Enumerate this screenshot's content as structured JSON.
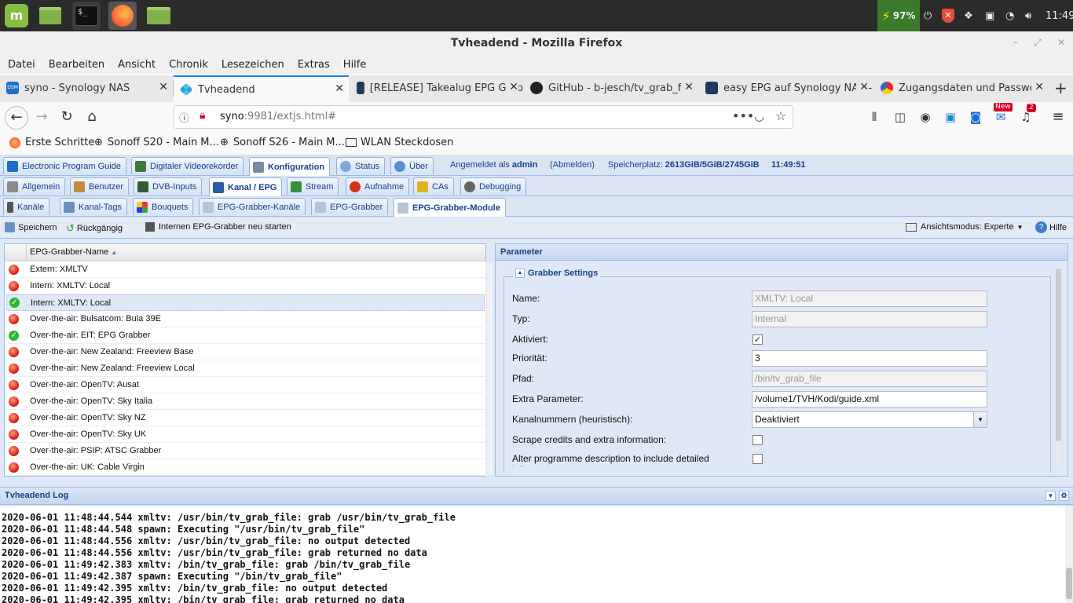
{
  "taskbar": {
    "battery": "97%",
    "clock": "11:49"
  },
  "window": {
    "title": "Tvheadend - Mozilla Firefox"
  },
  "menubar": [
    "Datei",
    "Bearbeiten",
    "Ansicht",
    "Chronik",
    "Lesezeichen",
    "Extras",
    "Hilfe"
  ],
  "tabs": [
    {
      "label": "syno - Synology NAS",
      "icon": "dsm-icon"
    },
    {
      "label": "Tvheadend",
      "icon": "tvheadend-icon"
    },
    {
      "label": "[RELEASE] Takealug EPG Grab",
      "icon": "kodi-icon"
    },
    {
      "label": "GitHub - b-jesch/tv_grab_file",
      "icon": "github-icon"
    },
    {
      "label": "easy EPG auf Synology NAS -",
      "icon": "kodi-icon"
    },
    {
      "label": "Zugangsdaten und Passwört",
      "icon": "takealug-icon"
    }
  ],
  "url": {
    "host": "syno",
    "rest": ":9981/extjs.html#"
  },
  "toolbar_badges": {
    "new": "New",
    "count": "2"
  },
  "bookmarks": [
    "Erste Schritte",
    "Sonoff S20 - Main M...",
    "Sonoff S26 - Main M...",
    "WLAN Steckdosen"
  ],
  "tvh": {
    "main_tabs": [
      "Electronic Program Guide",
      "Digitaler Videorekorder",
      "Konfiguration",
      "Status",
      "Über"
    ],
    "info": {
      "logged_in_prefix": "Angemeldet als",
      "user": "admin",
      "logout": "(Abmelden)",
      "storage_label": "Speicherplatz:",
      "storage_value": "2613GiB/5GiB/2745GiB",
      "time": "11:49:51"
    },
    "config_tabs": [
      "Allgemein",
      "Benutzer",
      "DVB-Inputs",
      "Kanal / EPG",
      "Stream",
      "Aufnahme",
      "CAs",
      "Debugging"
    ],
    "epg_tabs": [
      "Kanäle",
      "Kanal-Tags",
      "Bouquets",
      "EPG-Grabber-Kanäle",
      "EPG-Grabber",
      "EPG-Grabber-Module"
    ],
    "actions": {
      "save": "Speichern",
      "undo": "Rückgängig",
      "restart": "Internen EPG-Grabber neu starten",
      "view_mode": "Ansichtsmodus: Experte",
      "help": "Hilfe"
    },
    "grid": {
      "column": "EPG-Grabber-Name",
      "rows": [
        {
          "name": "Extern: XMLTV",
          "status": "red"
        },
        {
          "name": "Intern: XMLTV: Local",
          "status": "red"
        },
        {
          "name": "Intern: XMLTV: Local",
          "status": "green"
        },
        {
          "name": "Over-the-air: Bulsatcom: Bula 39E",
          "status": "red"
        },
        {
          "name": "Over-the-air: EIT: EPG Grabber",
          "status": "green"
        },
        {
          "name": "Over-the-air: New Zealand: Freeview Base",
          "status": "red"
        },
        {
          "name": "Over-the-air: New Zealand: Freeview Local",
          "status": "red"
        },
        {
          "name": "Over-the-air: OpenTV: Ausat",
          "status": "red"
        },
        {
          "name": "Over-the-air: OpenTV: Sky Italia",
          "status": "red"
        },
        {
          "name": "Over-the-air: OpenTV: Sky NZ",
          "status": "red"
        },
        {
          "name": "Over-the-air: OpenTV: Sky UK",
          "status": "red"
        },
        {
          "name": "Over-the-air: PSIP: ATSC Grabber",
          "status": "red"
        },
        {
          "name": "Over-the-air: UK: Cable Virgin",
          "status": "red"
        }
      ]
    },
    "params": {
      "panel_title": "Parameter",
      "section": "Grabber Settings",
      "name_label": "Name:",
      "name_value": "XMLTV: Local",
      "type_label": "Typ:",
      "type_value": "Internal",
      "enabled_label": "Aktiviert:",
      "enabled": true,
      "priority_label": "Priorität:",
      "priority_value": "3",
      "path_label": "Pfad:",
      "path_value": "/bin/tv_grab_file",
      "extra_label": "Extra Parameter:",
      "extra_value": "/volume1/TVH/Kodi/guide.xml",
      "channel_label": "Kanalnummern (heuristisch):",
      "channel_value": "Deaktiviert",
      "scrape_label": "Scrape credits and extra information:",
      "alter_label": "Alter programme description to include detailed information"
    },
    "log": {
      "title": "Tvheadend Log",
      "lines": [
        "2020-06-01 11:48:44.544 xmltv: /usr/bin/tv_grab_file: grab /usr/bin/tv_grab_file",
        "2020-06-01 11:48:44.548 spawn: Executing \"/usr/bin/tv_grab_file\"",
        "2020-06-01 11:48:44.556 xmltv: /usr/bin/tv_grab_file: no output detected",
        "2020-06-01 11:48:44.556 xmltv: /usr/bin/tv_grab_file: grab returned no data",
        "2020-06-01 11:49:42.383 xmltv: /bin/tv_grab_file: grab /bin/tv_grab_file",
        "2020-06-01 11:49:42.387 spawn: Executing \"/bin/tv_grab_file\"",
        "2020-06-01 11:49:42.395 xmltv: /bin/tv_grab_file: no output detected",
        "2020-06-01 11:49:42.395 xmltv: /bin/tv_grab_file: grab returned no data"
      ]
    }
  }
}
